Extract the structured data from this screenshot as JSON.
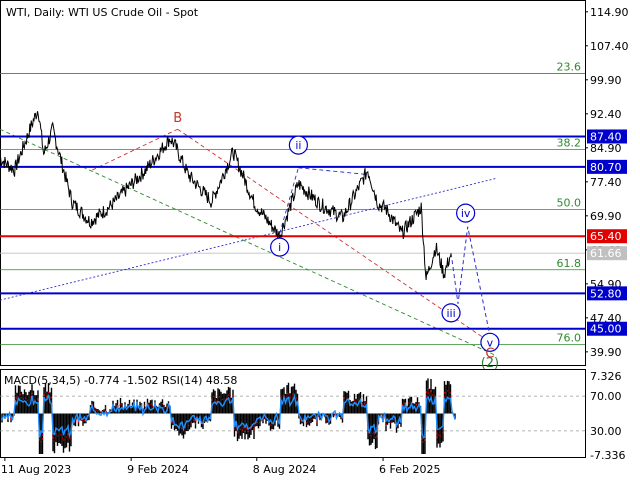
{
  "header": {
    "symbol": "WTI",
    "timeframe": "Daily",
    "description": "WTI US Crude Oil - Spot",
    "title_text": "WTI, Daily:  WTI US Crude Oil - Spot"
  },
  "indicator_header": "MACD(5,34,5) -0.774 -1.502 RSI(14) 48.58",
  "chart_data": [
    {
      "type": "line",
      "name": "WTI, Daily",
      "y_axis_labels": [
        "114.90",
        "107.40",
        "99.90",
        "92.40",
        "84.90",
        "77.40",
        "69.90",
        "62.40",
        "54.90",
        "47.40",
        "39.90"
      ],
      "ylim": [
        37.0,
        117.5
      ],
      "x_tick_labels": [
        "11 Aug 2023",
        "9 Feb 2024",
        "8 Aug 2024",
        "6 Feb 2025"
      ],
      "x_tick_dates": [
        "2023-08-11",
        "2024-02-09",
        "2024-08-08",
        "2025-02-06"
      ],
      "x_range": [
        "2023-08-04",
        "2025-05-25"
      ],
      "price_path": [
        {
          "date": "2023-08-04",
          "value": 82.5
        },
        {
          "date": "2023-08-25",
          "value": 80.0
        },
        {
          "date": "2023-09-20",
          "value": 90.5
        },
        {
          "date": "2023-09-28",
          "value": 93.5
        },
        {
          "date": "2023-10-06",
          "value": 83.5
        },
        {
          "date": "2023-10-19",
          "value": 89.0
        },
        {
          "date": "2023-11-16",
          "value": 72.9
        },
        {
          "date": "2023-12-12",
          "value": 68.6
        },
        {
          "date": "2024-01-10",
          "value": 72.0
        },
        {
          "date": "2024-02-09",
          "value": 76.8
        },
        {
          "date": "2024-03-01",
          "value": 80.0
        },
        {
          "date": "2024-04-05",
          "value": 87.0
        },
        {
          "date": "2024-04-12",
          "value": 85.5
        },
        {
          "date": "2024-05-01",
          "value": 79.0
        },
        {
          "date": "2024-06-04",
          "value": 73.0
        },
        {
          "date": "2024-07-05",
          "value": 84.0
        },
        {
          "date": "2024-08-05",
          "value": 72.5
        },
        {
          "date": "2024-09-10",
          "value": 65.5
        },
        {
          "date": "2024-10-07",
          "value": 77.0
        },
        {
          "date": "2024-11-07",
          "value": 72.5
        },
        {
          "date": "2024-12-10",
          "value": 69.5
        },
        {
          "date": "2025-01-15",
          "value": 80.0
        },
        {
          "date": "2025-01-30",
          "value": 72.5
        },
        {
          "date": "2025-02-10",
          "value": 71.5
        },
        {
          "date": "2025-03-05",
          "value": 66.0
        },
        {
          "date": "2025-04-02",
          "value": 71.8
        },
        {
          "date": "2025-04-09",
          "value": 56.0
        },
        {
          "date": "2025-04-23",
          "value": 63.0
        },
        {
          "date": "2025-05-05",
          "value": 57.0
        },
        {
          "date": "2025-05-15",
          "value": 61.66
        }
      ],
      "current_price": "61.66",
      "key_levels": [
        {
          "label": "87.40",
          "value": 87.4,
          "color": "#0000cc",
          "label_bg": "#0000cc"
        },
        {
          "label": "80.70",
          "value": 80.7,
          "color": "#0000cc",
          "label_bg": "#0000cc"
        },
        {
          "label": "65.40",
          "value": 65.4,
          "color": "#e00000",
          "label_bg": "#e00000"
        },
        {
          "label": "52.80",
          "value": 52.8,
          "color": "#0000cc",
          "label_bg": "#0000cc"
        },
        {
          "label": "45.00",
          "value": 45.0,
          "color": "#0000cc",
          "label_bg": "#0000cc"
        }
      ],
      "fibonacci_levels": [
        {
          "label": "23.6",
          "value": 101.3
        },
        {
          "label": "38.2",
          "value": 84.5
        },
        {
          "label": "50.0",
          "value": 71.3
        },
        {
          "label": "61.8",
          "value": 58.0
        },
        {
          "label": "76.0",
          "value": 41.5
        }
      ],
      "wave_labels": [
        {
          "text": "B",
          "date": "2024-04-16",
          "value": 91.5,
          "color": "#c0392b",
          "circled": false
        },
        {
          "text": "i",
          "date": "2024-09-10",
          "value": 63.0,
          "color": "#0000cc",
          "circled": true
        },
        {
          "text": "ii",
          "date": "2024-10-07",
          "value": 85.5,
          "color": "#0000cc",
          "circled": true
        },
        {
          "text": "iii",
          "date": "2025-05-15",
          "value": 48.5,
          "color": "#0000cc",
          "circled": true
        },
        {
          "text": "iv",
          "date": "2025-06-05",
          "value": 70.5,
          "color": "#0000cc",
          "circled": true
        },
        {
          "text": "v",
          "date": "2025-07-10",
          "value": 42.0,
          "color": "#0000cc",
          "circled": true
        },
        {
          "text": "C",
          "date": "2025-07-10",
          "value": 39.5,
          "color": "#c0392b",
          "circled": false
        },
        {
          "text": "(2)",
          "date": "2025-07-10",
          "value": 37.4,
          "color": "#2e7d32",
          "circled": false
        }
      ],
      "forecast_path": [
        {
          "date": "2025-05-15",
          "value": 61.66
        },
        {
          "date": "2025-05-25",
          "value": 50.5
        },
        {
          "date": "2025-06-08",
          "value": 67.5
        },
        {
          "date": "2025-07-10",
          "value": 43.5
        }
      ],
      "channel_lines": [
        {
          "color": "#2e2ecc",
          "style": "dotted",
          "points": [
            {
              "date": "2023-08-04",
              "value": 51.3
            },
            {
              "date": "2025-07-20",
              "value": 78.2
            }
          ]
        },
        {
          "color": "#2e8b2e",
          "style": "dashed",
          "points": [
            {
              "date": "2023-08-04",
              "value": 89.0
            },
            {
              "date": "2025-07-20",
              "value": 39.0
            }
          ]
        },
        {
          "color": "#cc3333",
          "style": "dashed",
          "points": [
            {
              "date": "2024-04-16",
              "value": 89.0
            },
            {
              "date": "2025-07-20",
              "value": 41.0
            }
          ]
        },
        {
          "color": "#cc3333",
          "style": "dashed",
          "points": [
            {
              "date": "2023-12-15",
              "value": 80.0
            },
            {
              "date": "2024-04-16",
              "value": 89.0
            }
          ]
        },
        {
          "color": "#2e2ecc",
          "style": "dashed",
          "points": [
            {
              "date": "2024-09-10",
              "value": 66.0
            },
            {
              "date": "2024-10-07",
              "value": 80.5
            }
          ]
        },
        {
          "color": "#2e2ecc",
          "style": "dashed",
          "points": [
            {
              "date": "2024-10-07",
              "value": 80.5
            },
            {
              "date": "2025-01-15",
              "value": 79.0
            }
          ]
        }
      ],
      "grid": false
    },
    {
      "type": "bar",
      "name": "MACD(5,34,5) / RSI(14)",
      "y_axis_labels": [
        "7.326",
        "70.00",
        "30.00",
        "-7.336"
      ],
      "macd_range": [
        -7.336,
        7.326
      ],
      "rsi_levels": [
        70,
        30
      ],
      "macd_last": -0.774,
      "signal_last": -1.502,
      "rsi_last": 48.58
    }
  ],
  "colors": {
    "background": "#ffffff",
    "price_line": "#000000",
    "macd_histogram": "#000000",
    "rsi_line": "#1e90ff",
    "signal_line": "#e00000",
    "fib_line": "#2e8b2e",
    "axis_text": "#000000",
    "current_price_label_bg": "#c0c0c0"
  }
}
